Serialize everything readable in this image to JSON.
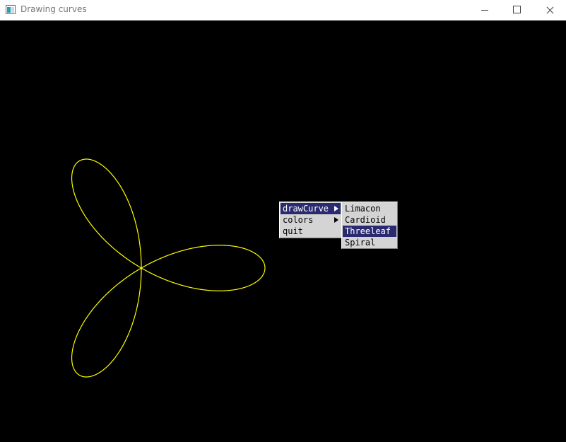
{
  "window": {
    "title": "Drawing curves",
    "background": "#000000"
  },
  "curve": {
    "name": "Threeleaf",
    "color": "#ffff00"
  },
  "menu": {
    "items": [
      {
        "label": "drawCurve",
        "has_submenu": true,
        "highlighted": true
      },
      {
        "label": "colors",
        "has_submenu": true,
        "highlighted": false
      },
      {
        "label": "quit",
        "has_submenu": false,
        "highlighted": false
      }
    ],
    "highlight_color": "#2a2a70"
  },
  "submenu": {
    "items": [
      {
        "label": "Limacon",
        "highlighted": false
      },
      {
        "label": "Cardioid",
        "highlighted": false
      },
      {
        "label": "Threeleaf",
        "highlighted": true
      },
      {
        "label": "Spiral",
        "highlighted": false
      }
    ]
  },
  "icons": {
    "app": "app-window-icon",
    "minimize": "minimize-icon",
    "maximize": "maximize-icon",
    "close": "close-icon",
    "submenu_arrow": "triangle-right-icon"
  }
}
